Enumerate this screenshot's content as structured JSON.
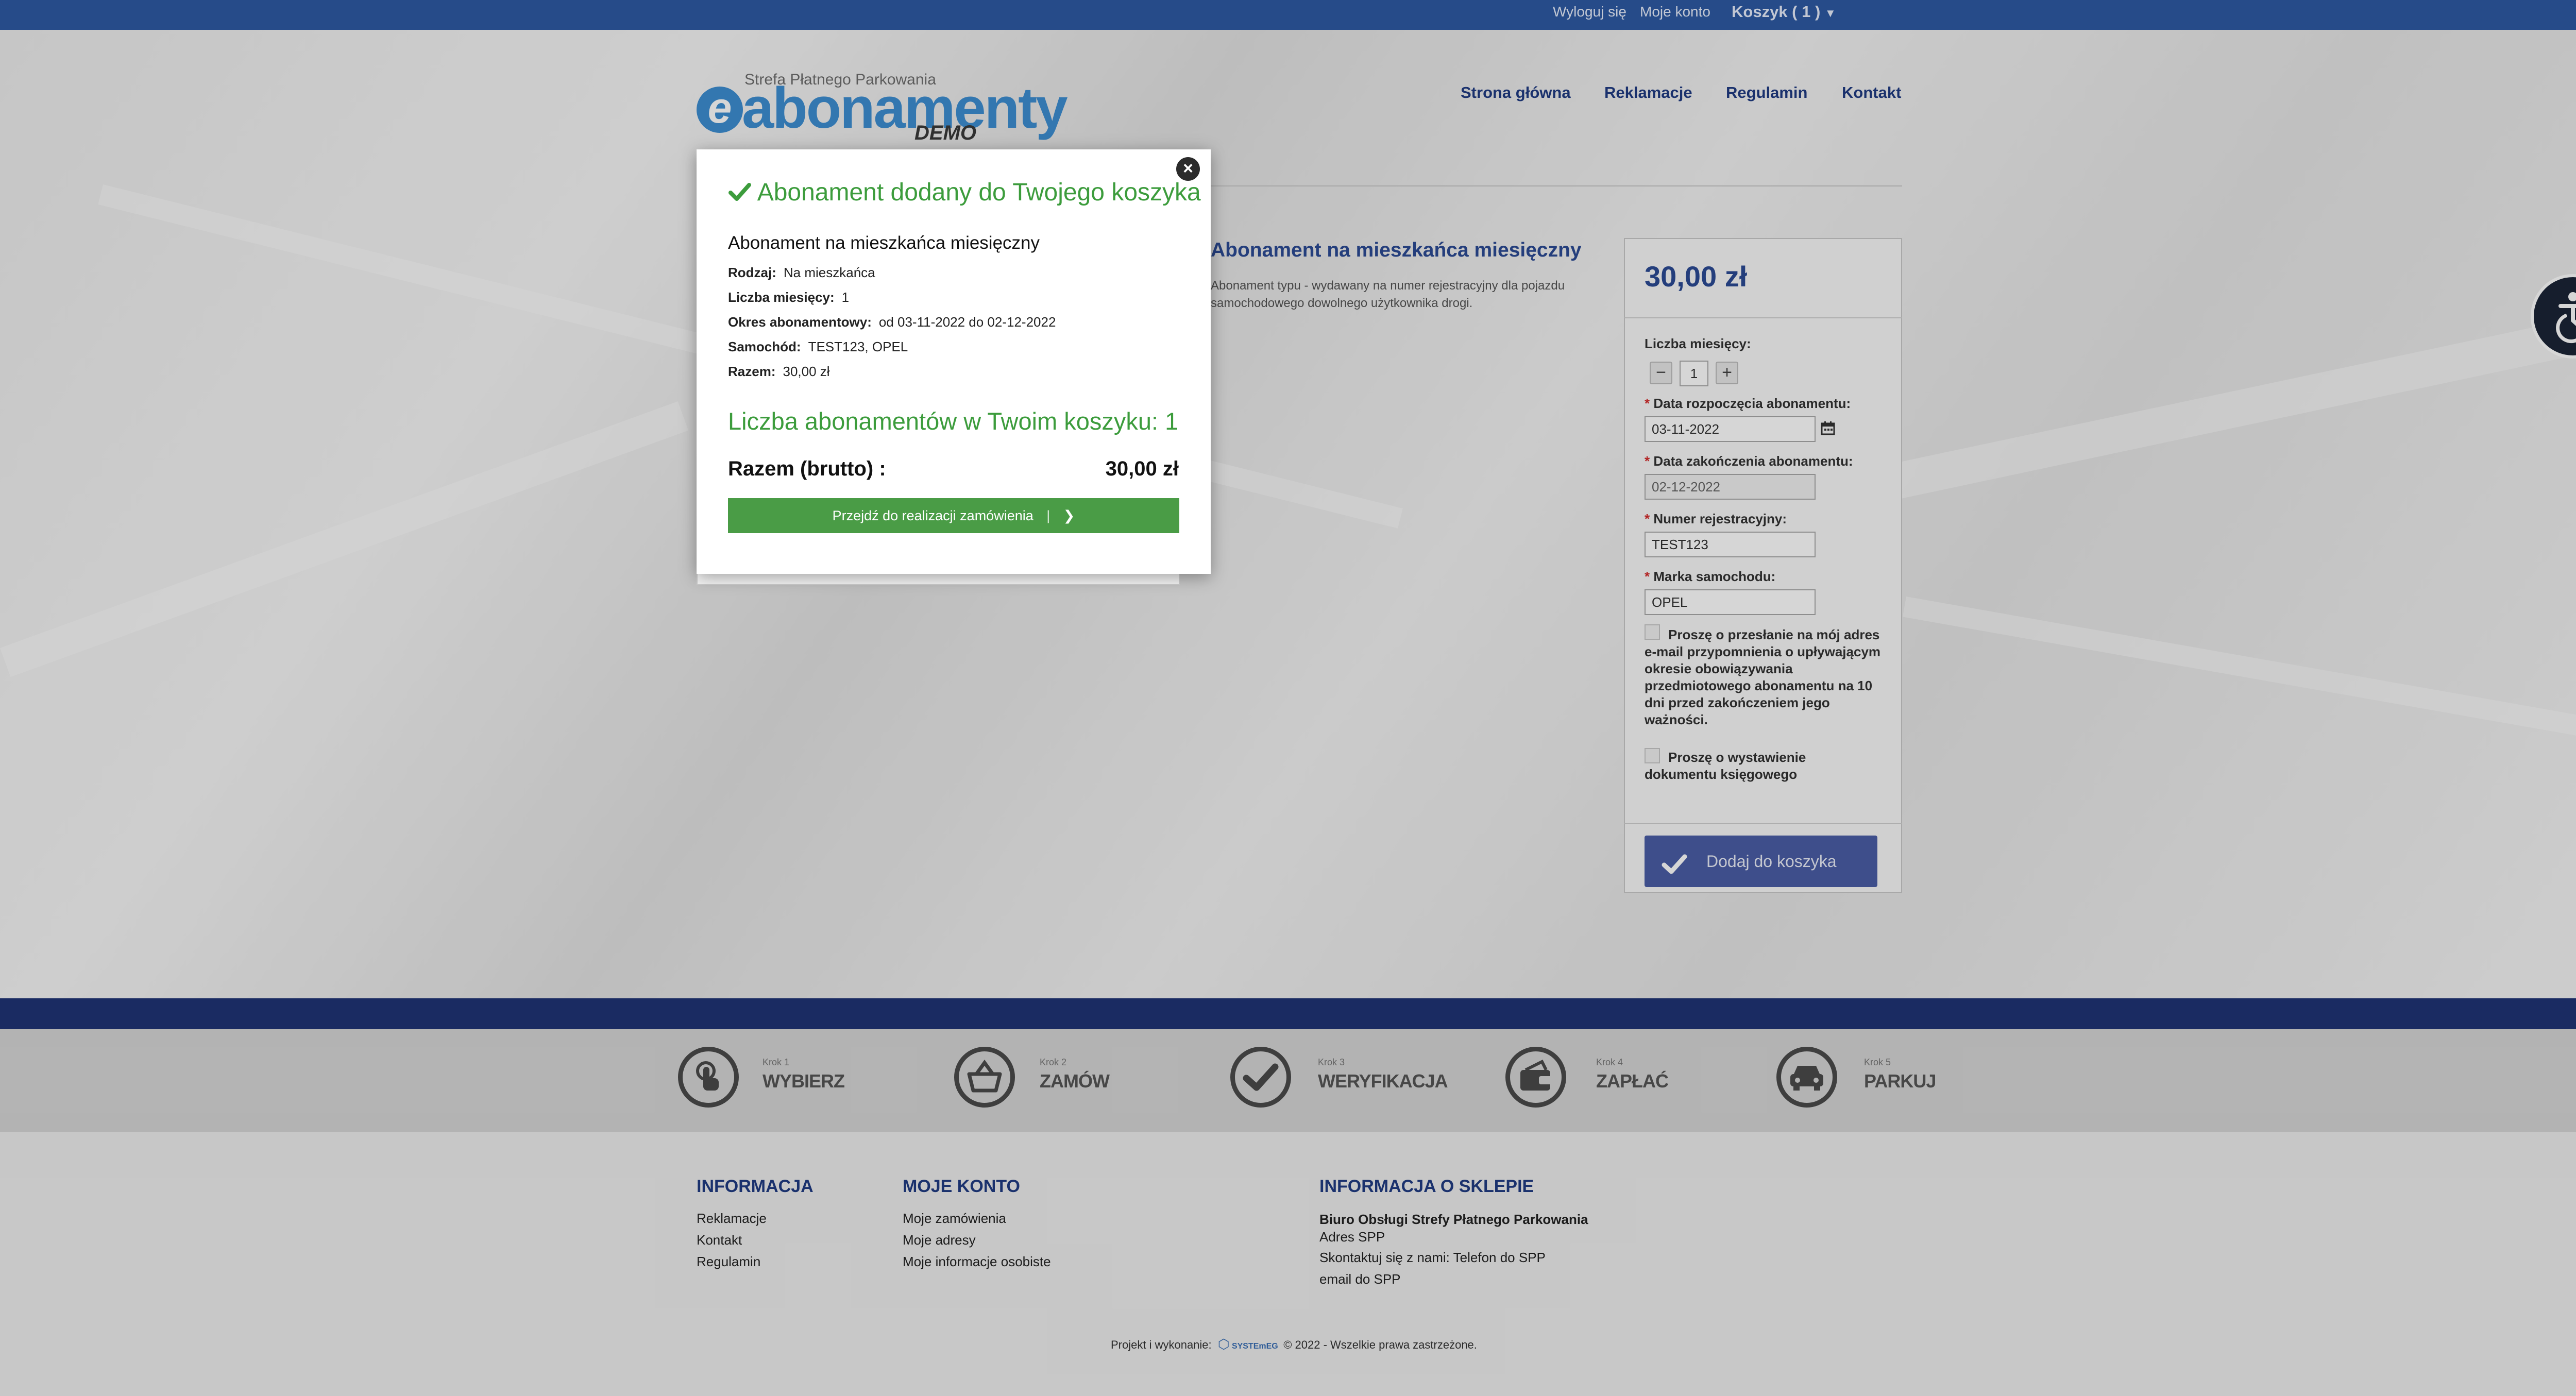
{
  "topbar": {
    "logout": "Wyloguj się",
    "account": "Moje konto",
    "cart": "Koszyk ( 1 )"
  },
  "logo": {
    "subtitle": "Strefa Płatnego Parkowania",
    "e": "e",
    "main": "abonamenty",
    "demo": "DEMO"
  },
  "nav": [
    "Strona główna",
    "Reklamacje",
    "Regulamin",
    "Kontakt"
  ],
  "product": {
    "title": "Abonament na mieszkańca miesięczny",
    "description": "Abonament typu  - wydawany na numer rejestracyjny  dla pojazdu samochodowego dowolnego użytkownika drogi."
  },
  "panel": {
    "price": "30,00 zł",
    "months_label": "Liczba miesięcy:",
    "months_value": "1",
    "minus": "−",
    "plus": "+",
    "start_label": "Data rozpoczęcia abonamentu:",
    "start_value": "03-11-2022",
    "end_label": "Data zakończenia abonamentu:",
    "end_value": "02-12-2022",
    "reg_label": "Numer rejestracyjny:",
    "reg_value": "TEST123",
    "brand_label": "Marka samochodu:",
    "brand_value": "OPEL",
    "reminder_text": "Proszę o przesłanie na mój adres e-mail przypomnienia o upływającym okresie obowiązywania przedmiotowego abonamentu na 10 dni przed zakończeniem jego ważności.",
    "invoice_text": "Proszę o wystawienie dokumentu księgowego",
    "add_button": "Dodaj do koszyka"
  },
  "modal": {
    "title": "Abonament dodany do Twojego koszyka",
    "product": "Abonament na mieszkańca miesięczny",
    "rows": [
      {
        "label": "Rodzaj:",
        "value": "Na mieszkańca"
      },
      {
        "label": "Liczba miesięcy:",
        "value": "1"
      },
      {
        "label": "Okres abonamentowy:",
        "value": "od 03-11-2022 do 02-12-2022"
      },
      {
        "label": "Samochód:",
        "value": "TEST123, OPEL"
      },
      {
        "label": "Razem:",
        "value": "30,00 zł"
      }
    ],
    "count": "Liczba abonamentów w Twoim koszyku: 1",
    "total_label": "Razem (brutto) :",
    "total_value": "30,00 zł",
    "button": "Przejdź do realizacji zamówienia",
    "close": "×"
  },
  "steps": [
    {
      "small": "Krok 1",
      "big": "WYBIERZ",
      "icon": "hand-pointer-icon"
    },
    {
      "small": "Krok 2",
      "big": "ZAMÓW",
      "icon": "basket-icon"
    },
    {
      "small": "Krok 3",
      "big": "WERYFIKACJA",
      "icon": "check-icon"
    },
    {
      "small": "Krok 4",
      "big": "ZAPŁAĆ",
      "icon": "wallet-icon"
    },
    {
      "small": "Krok 5",
      "big": "PARKUJ",
      "icon": "car-icon"
    }
  ],
  "footer": {
    "info_head": "INFORMACJA",
    "info_links": [
      "Reklamacje",
      "Kontakt",
      "Regulamin"
    ],
    "account_head": "MOJE KONTO",
    "account_links": [
      "Moje zamówienia",
      "Moje adresy",
      "Moje informacje osobiste"
    ],
    "shop_head": "INFORMACJA O SKLEPIE",
    "shop_name": "Biuro Obsługi Strefy Płatnego Parkowania",
    "shop_lines": [
      "Adres SPP",
      "Skontaktuj się z nami: Telefon do SPP",
      "email do SPP"
    ],
    "copy_prefix": "Projekt i wykonanie:",
    "copy_brand": "SYSTEmEG",
    "copy_suffix": "© 2022 - Wszelkie prawa zastrzeżone."
  },
  "colors": {
    "topbar": "#2e5aa4",
    "brand_blue": "#2c4a94",
    "success_green": "#3c9c3c",
    "button_green": "#4a9c46",
    "add_button": "#4b5ea6",
    "footer_band": "#1f3475"
  }
}
